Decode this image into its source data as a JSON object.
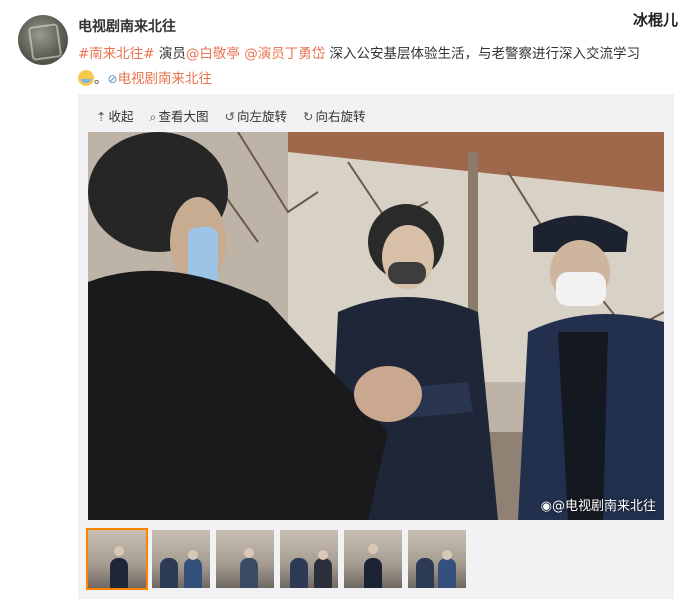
{
  "post": {
    "username": "电视剧南来北往",
    "corner_watermark": "冰棍儿",
    "text": {
      "hashtag": "#南来北往#",
      "t1": " 演员",
      "mention1": "@白敬亭",
      "t2": " ",
      "mention2": "@演员丁勇岱",
      "t3": " 深入公安基层体验生活，与老警察进行深入交流学习",
      "t4": "。",
      "link": "电视剧南来北往"
    }
  },
  "media": {
    "toolbar": {
      "collapse": "收起",
      "view_large": "查看大图",
      "rotate_left": "向左旋转",
      "rotate_right": "向右旋转"
    },
    "photo_watermark": "@电视剧南来北往",
    "thumbnail_count": 6,
    "active_thumbnail": 1
  },
  "colors": {
    "link": "#eb7350",
    "active_thumb_border": "#ff8200"
  }
}
